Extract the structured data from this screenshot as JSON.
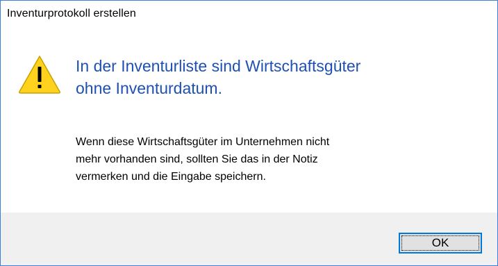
{
  "window": {
    "title": "Inventurprotokoll erstellen"
  },
  "message": {
    "icon": "warning-icon",
    "main_instruction_lines": [
      "In der Inventurliste sind Wirtschaftsgüter",
      "ohne Inventurdatum."
    ],
    "content_lines": [
      "Wenn diese Wirtschaftsgüter im Unternehmen nicht",
      "mehr vorhanden sind, sollten Sie das in der Notiz",
      "vermerken und die Eingabe speichern."
    ]
  },
  "buttons": {
    "ok_label": "OK"
  },
  "colors": {
    "main_instruction": "#1e50b4",
    "warning_fill": "#ffd21e",
    "button_focus_border": "#0078d7",
    "window_border": "#3c7fd6"
  }
}
